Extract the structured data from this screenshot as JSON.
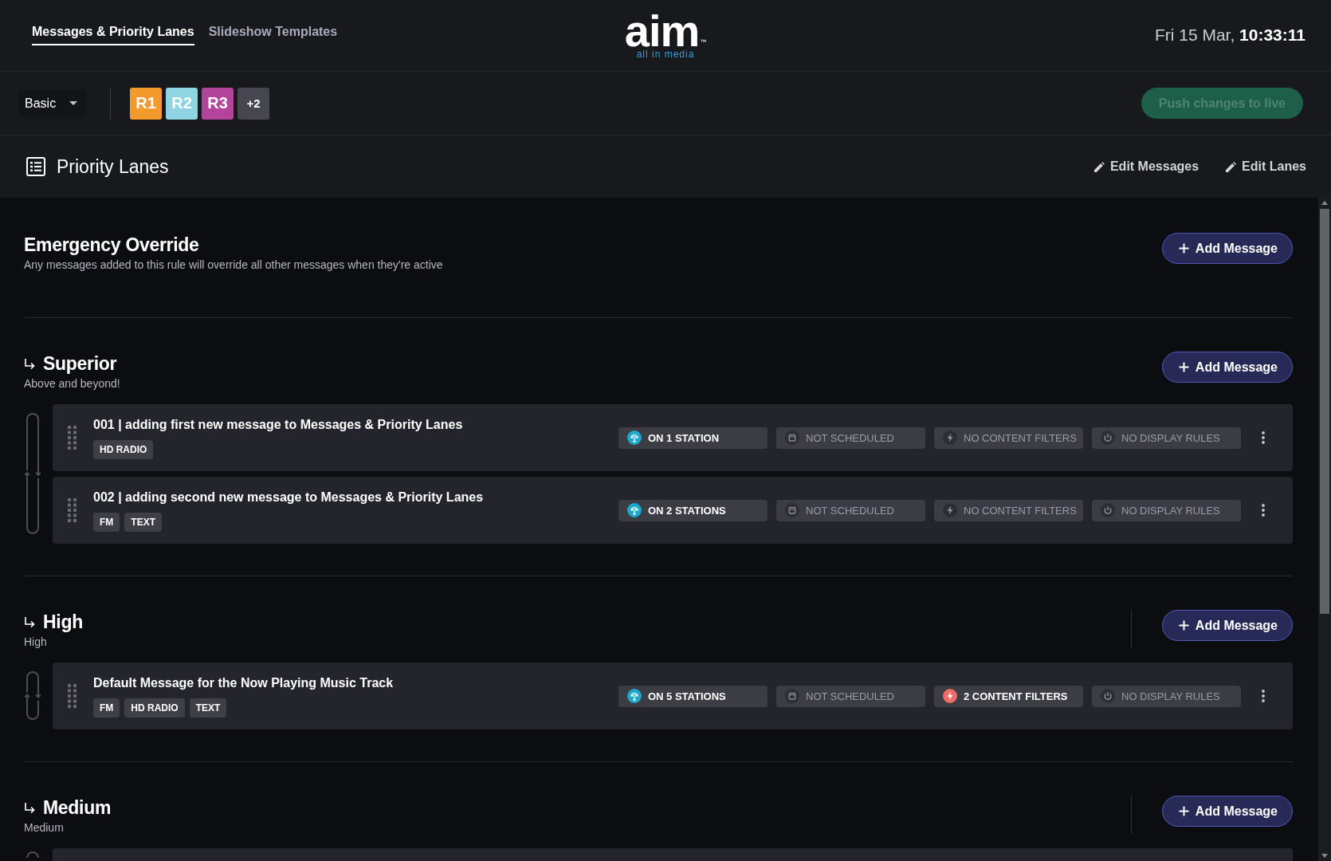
{
  "header": {
    "tabs": [
      {
        "label": "Messages & Priority Lanes",
        "selected": true
      },
      {
        "label": "Slideshow Templates",
        "selected": false
      }
    ],
    "logo": {
      "wordmark": "aim",
      "trademark": "™",
      "tagline": "all in media"
    },
    "clock": "Fri 15 Mar, **10:33:11**"
  },
  "toolbar": {
    "view_select": {
      "value": "Basic"
    },
    "stations": [
      {
        "kind": "station",
        "label": "R1",
        "color": "#f39a2c"
      },
      {
        "kind": "station",
        "label": "R2",
        "color": "#8fd4e2"
      },
      {
        "kind": "station",
        "label": "R3",
        "color": "#b3449c"
      },
      {
        "kind": "more",
        "label": "+2",
        "color": "#45464f"
      }
    ],
    "push_button": {
      "label": "Push changes to live",
      "disabled": true
    }
  },
  "section": {
    "title": "Priority Lanes",
    "actions": [
      "Edit Messages",
      "Edit Lanes"
    ]
  },
  "lanes": [
    {
      "kind": "override",
      "title": "Emergency Override",
      "description": "Any messages added to this rule will override all other messages when they're active",
      "separator": false,
      "add_button": "Add Message",
      "cut_off_message": false
    },
    {
      "kind": "lane",
      "title": "Superior",
      "description": "Above and beyond!",
      "separator": false,
      "add_button": "Add Message",
      "cut_off_message": false,
      "messages": [
        {
          "title": "001 | adding first new message to Messages & Priority Lanes",
          "tags": [
            "HD RADIO"
          ],
          "chips": [
            {
              "kind": "stations",
              "label": "ON 1 STATION",
              "active": true
            },
            {
              "kind": "schedule",
              "label": "NOT SCHEDULED",
              "active": false
            },
            {
              "kind": "filters",
              "label": "NO CONTENT FILTERS",
              "active": false
            },
            {
              "kind": "display_rules",
              "label": "NO DISPLAY RULES",
              "active": false
            }
          ]
        },
        {
          "title": "002 | adding second new message to Messages & Priority Lanes",
          "tags": [
            "FM",
            "TEXT"
          ],
          "chips": [
            {
              "kind": "stations",
              "label": "ON 2 STATIONS",
              "active": true
            },
            {
              "kind": "schedule",
              "label": "NOT SCHEDULED",
              "active": false
            },
            {
              "kind": "filters",
              "label": "NO CONTENT FILTERS",
              "active": false
            },
            {
              "kind": "display_rules",
              "label": "NO DISPLAY RULES",
              "active": false
            }
          ]
        }
      ]
    },
    {
      "kind": "lane",
      "title": "High",
      "description": "High",
      "separator": true,
      "add_button": "Add Message",
      "cut_off_message": false,
      "messages": [
        {
          "title": "Default Message for the Now Playing Music Track",
          "tags": [
            "FM",
            "HD RADIO",
            "TEXT"
          ],
          "chips": [
            {
              "kind": "stations",
              "label": "ON 5 STATIONS",
              "active": true
            },
            {
              "kind": "schedule",
              "label": "NOT SCHEDULED",
              "active": false
            },
            {
              "kind": "filters",
              "label": "2 CONTENT FILTERS",
              "active": true
            },
            {
              "kind": "display_rules",
              "label": "NO DISPLAY RULES",
              "active": false
            }
          ]
        }
      ]
    },
    {
      "kind": "lane",
      "title": "Medium",
      "description": "Medium",
      "separator": true,
      "add_button": "Add Message",
      "cut_off_message": true
    }
  ]
}
